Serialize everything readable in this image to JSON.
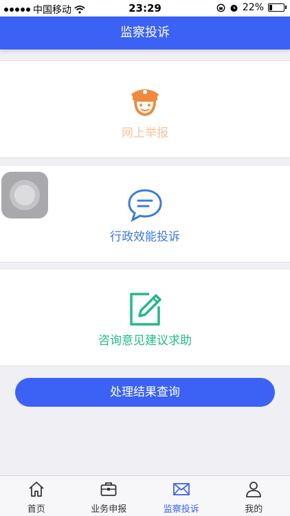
{
  "status_bar": {
    "carrier": "中国移动",
    "time": "23:29",
    "battery": "22%",
    "battery_level": 0.22
  },
  "header": {
    "title": "监察投诉"
  },
  "cards": [
    {
      "label": "网上举报",
      "icon": "police-officer-icon",
      "color": "#f4c39a",
      "icon_color": "#f08a3c"
    },
    {
      "label": "行政效能投诉",
      "icon": "chat-bubble-icon",
      "color": "#3b7bd8"
    },
    {
      "label": "咨询意见建议求助",
      "icon": "edit-note-icon",
      "color": "#22b98a"
    }
  ],
  "query_button": {
    "label": "处理结果查询"
  },
  "tabbar": {
    "items": [
      {
        "label": "首页",
        "icon": "home-icon",
        "active": false
      },
      {
        "label": "业务申报",
        "icon": "briefcase-icon",
        "active": false
      },
      {
        "label": "监察投诉",
        "icon": "mail-icon",
        "active": true
      },
      {
        "label": "我的",
        "icon": "user-icon",
        "active": false
      }
    ]
  },
  "colors": {
    "brand": "#3b62f4",
    "background": "#efeff4"
  }
}
